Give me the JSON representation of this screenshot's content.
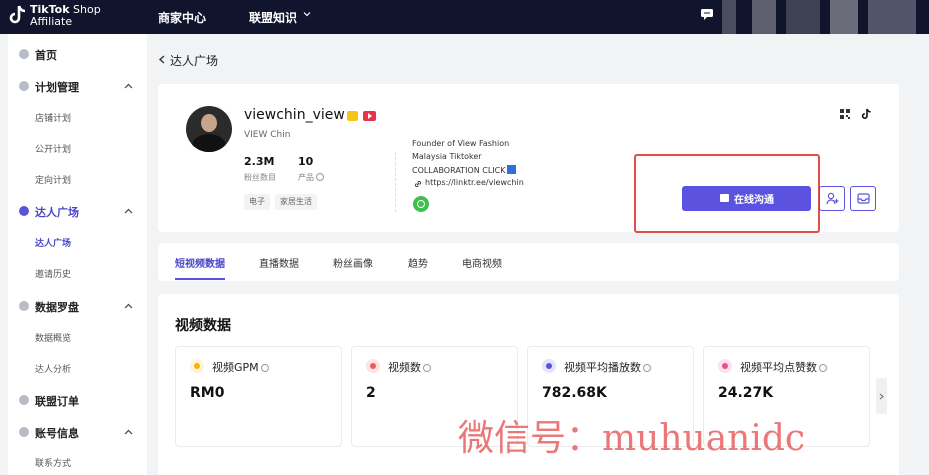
{
  "header": {
    "logo_line1_bold": "TikTok",
    "logo_line1_light": " Shop",
    "logo_line2": "Affiliate",
    "nav": [
      "商家中心",
      "联盟知识"
    ]
  },
  "sidebar": {
    "items": [
      {
        "label": "首页",
        "icon": "home-icon",
        "subs": []
      },
      {
        "label": "计划管理",
        "icon": "plan-icon",
        "subs": [
          "店铺计划",
          "公开计划",
          "定向计划"
        ]
      },
      {
        "label": "达人广场",
        "icon": "creator-icon",
        "subs": [
          "达人广场",
          "邀请历史"
        ]
      },
      {
        "label": "数据罗盘",
        "icon": "compass-icon",
        "subs": [
          "数据概览",
          "达人分析"
        ]
      },
      {
        "label": "联盟订单",
        "icon": "order-icon",
        "subs": []
      },
      {
        "label": "账号信息",
        "icon": "account-icon",
        "subs": [
          "联系方式"
        ]
      }
    ],
    "active_section": "达人广场",
    "active_sub": "达人广场"
  },
  "breadcrumb": "达人广场",
  "profile": {
    "username": "viewchin_view",
    "nickname": "VIEW Chin",
    "stats": [
      {
        "value": "2.3M",
        "label": "粉丝数目"
      },
      {
        "value": "10",
        "label": "产品"
      }
    ],
    "tags": [
      "电子",
      "家居生活"
    ],
    "bio": [
      "Founder of View Fashion",
      "Malaysia Tiktoker",
      "COLLABORATION CLICK"
    ],
    "link": "https://linktr.ee/viewchin",
    "chat_button": "在线沟通",
    "colors": {
      "accent": "#5b52e0",
      "highlight_box": "#e0504a"
    }
  },
  "tabs": [
    "短视频数据",
    "直播数据",
    "粉丝画像",
    "趋势",
    "电商视频"
  ],
  "active_tab": "短视频数据",
  "video_data": {
    "title": "视频数据",
    "metrics": [
      {
        "label": "视频GPM",
        "value": "RM0",
        "icon": "gpm-icon",
        "color": "#f5b400"
      },
      {
        "label": "视频数",
        "value": "2",
        "icon": "video-count-icon",
        "color": "#f05a5a"
      },
      {
        "label": "视频平均播放数",
        "value": "782.68K",
        "icon": "views-icon",
        "color": "#5b52e0"
      },
      {
        "label": "视频平均点赞数",
        "value": "24.27K",
        "icon": "likes-icon",
        "color": "#e8508f"
      }
    ]
  },
  "watermark": "微信号：muhuanidc"
}
